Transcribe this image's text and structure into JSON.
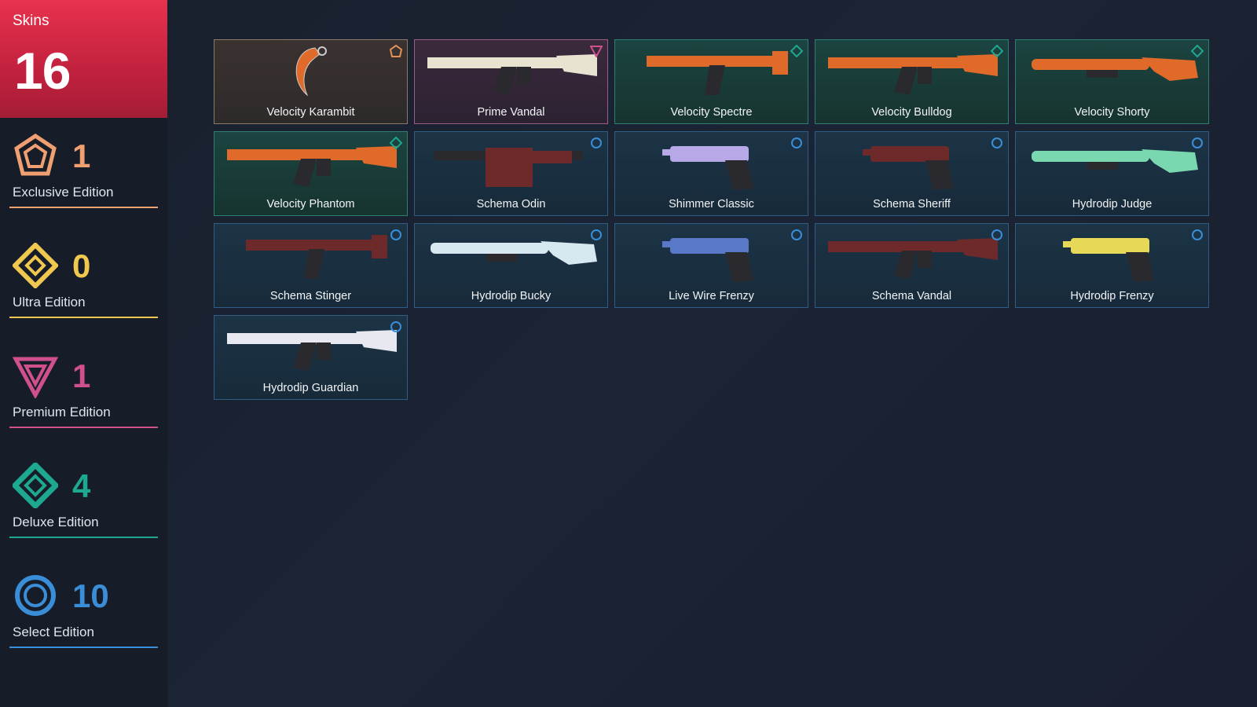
{
  "sidebar": {
    "total_label": "Skins",
    "total_count": "16",
    "tiers": [
      {
        "name": "Exclusive Edition",
        "count": "1",
        "color": "#f0a070",
        "icon": "exclusive-icon"
      },
      {
        "name": "Ultra Edition",
        "count": "0",
        "color": "#f0c850",
        "icon": "ultra-icon"
      },
      {
        "name": "Premium Edition",
        "count": "1",
        "color": "#d0508e",
        "icon": "premium-icon"
      },
      {
        "name": "Deluxe Edition",
        "count": "4",
        "color": "#1fa890",
        "icon": "deluxe-icon"
      },
      {
        "name": "Select Edition",
        "count": "10",
        "color": "#3a8ed8",
        "icon": "select-icon"
      }
    ]
  },
  "skins": [
    {
      "name": "Velocity Karambit",
      "tier": "exclusive",
      "color": "#e06a2a",
      "icon": "knife-icon"
    },
    {
      "name": "Prime Vandal",
      "tier": "premium",
      "color": "#e8e2d0",
      "icon": "rifle-icon"
    },
    {
      "name": "Velocity Spectre",
      "tier": "deluxe",
      "color": "#e06a2a",
      "icon": "smg-icon"
    },
    {
      "name": "Velocity Bulldog",
      "tier": "deluxe",
      "color": "#e06a2a",
      "icon": "rifle-icon"
    },
    {
      "name": "Velocity Shorty",
      "tier": "deluxe",
      "color": "#e06a2a",
      "icon": "shotgun-icon"
    },
    {
      "name": "Velocity Phantom",
      "tier": "deluxe",
      "color": "#e06a2a",
      "icon": "rifle-icon"
    },
    {
      "name": "Schema Odin",
      "tier": "select",
      "color": "#6e2a2a",
      "icon": "machinegun-icon"
    },
    {
      "name": "Shimmer Classic",
      "tier": "select",
      "color": "#b8a8e8",
      "icon": "pistol-icon"
    },
    {
      "name": "Schema Sheriff",
      "tier": "select",
      "color": "#6e2a2a",
      "icon": "revolver-icon"
    },
    {
      "name": "Hydrodip Judge",
      "tier": "select",
      "color": "#7ad8b0",
      "icon": "shotgun-icon"
    },
    {
      "name": "Schema Stinger",
      "tier": "select",
      "color": "#6e2a2a",
      "icon": "smg-icon"
    },
    {
      "name": "Hydrodip Bucky",
      "tier": "select",
      "color": "#d8e8f0",
      "icon": "shotgun-icon"
    },
    {
      "name": "Live Wire Frenzy",
      "tier": "select",
      "color": "#5a78c8",
      "icon": "pistol-icon"
    },
    {
      "name": "Schema Vandal",
      "tier": "select",
      "color": "#6e2a2a",
      "icon": "rifle-icon"
    },
    {
      "name": "Hydrodip Frenzy",
      "tier": "select",
      "color": "#e8d858",
      "icon": "pistol-icon"
    },
    {
      "name": "Hydrodip Guardian",
      "tier": "select",
      "color": "#e8e8f0",
      "icon": "rifle-icon"
    }
  ]
}
